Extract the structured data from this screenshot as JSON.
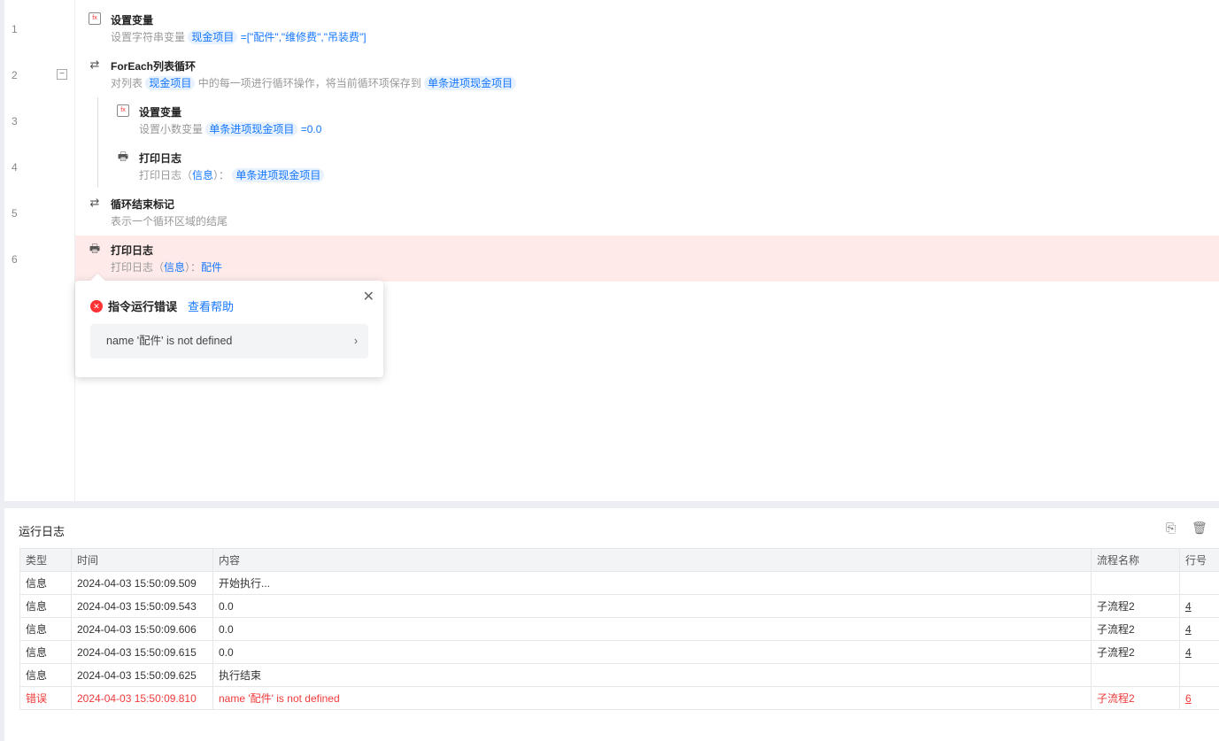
{
  "editor": {
    "rows": [
      {
        "line": "1",
        "title": "设置变量",
        "desc": "设置字符串变量",
        "var": "现金项目",
        "rest": "=[\"配件\",\"维修费\",\"吊装费\"]",
        "icon": "fx-icon"
      },
      {
        "line": "2",
        "title": "ForEach列表循环",
        "desc": "对列表",
        "var": "现金项目",
        "mid": "中的每一项进行循环操作，将当前循环项保存到",
        "var2": "单条进项现金项目",
        "icon": "loop-icon"
      },
      {
        "line": "3",
        "title": "设置变量",
        "desc": "设置小数变量",
        "var": "单条进项现金项目",
        "rest": "=0.0",
        "icon": "fx-icon"
      },
      {
        "line": "4",
        "title": "打印日志",
        "desc": "打印日志（",
        "level": "信息",
        "desc2": "）：",
        "var": "单条进项现金项目",
        "icon": "printer-icon"
      },
      {
        "line": "5",
        "title": "循环结束标记",
        "desc": "表示一个循环区域的结尾",
        "icon": "loop-end-icon"
      },
      {
        "line": "6",
        "title": "打印日志",
        "desc": "打印日志（",
        "level": "信息",
        "desc2": "）：",
        "val": "配件",
        "icon": "printer-icon"
      }
    ]
  },
  "popover": {
    "title": "指令运行错误",
    "help": "查看帮助",
    "message": "name '配件' is not defined"
  },
  "log": {
    "title": "运行日志",
    "columns": [
      "类型",
      "时间",
      "内容",
      "流程名称",
      "行号"
    ],
    "rows": [
      [
        "信息",
        "2024-04-03 15:50:09.509",
        "开始执行...",
        "",
        ""
      ],
      [
        "信息",
        "2024-04-03 15:50:09.543",
        "0.0",
        "子流程2",
        "4"
      ],
      [
        "信息",
        "2024-04-03 15:50:09.606",
        "0.0",
        "子流程2",
        "4"
      ],
      [
        "信息",
        "2024-04-03 15:50:09.615",
        "0.0",
        "子流程2",
        "4"
      ],
      [
        "信息",
        "2024-04-03 15:50:09.625",
        "执行结束",
        "",
        ""
      ],
      [
        "错误",
        "2024-04-03 15:50:09.810",
        " name '配件' is not defined",
        "子流程2",
        "6"
      ]
    ]
  },
  "colors": {
    "accent": "#1677ff",
    "error": "#f03a3a",
    "errorRow": "#feebe9"
  }
}
